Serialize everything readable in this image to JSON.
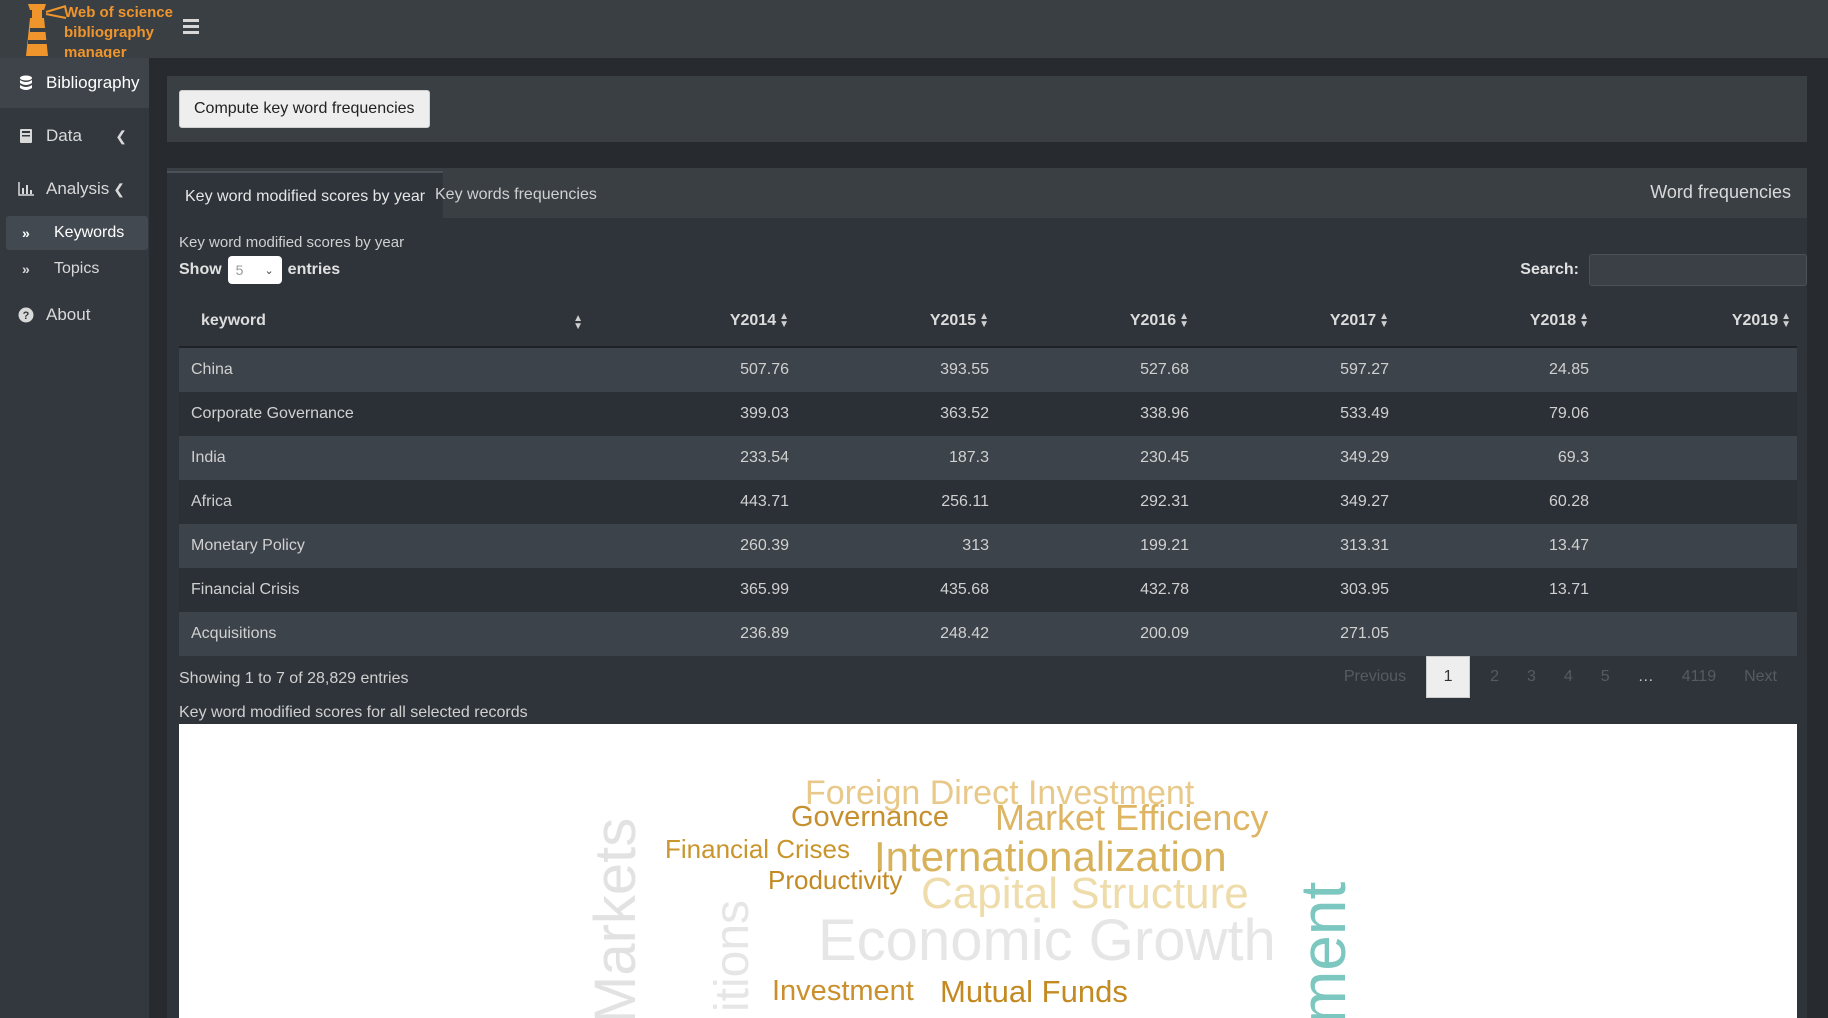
{
  "app": {
    "logo_lines": [
      "Web of science",
      "bibliography",
      "manager"
    ]
  },
  "sidebar": {
    "items": [
      {
        "label": "Bibliography",
        "icon": "database-icon"
      },
      {
        "label": "Data",
        "icon": "book-icon"
      },
      {
        "label": "Analysis",
        "icon": "bar-chart-icon"
      },
      {
        "label": "About",
        "icon": "question-circle-icon"
      }
    ],
    "subitems": [
      {
        "label": "Keywords",
        "icon": "angle-double-right-icon"
      },
      {
        "label": "Topics",
        "icon": "angle-double-right-icon"
      }
    ]
  },
  "toolbar": {
    "compute_label": "Compute key word frequencies"
  },
  "tabs": {
    "items": [
      "Key word modified scores by year",
      "Key words frequencies"
    ],
    "box_title": "Word frequencies"
  },
  "table_section": {
    "caption": "Key word modified scores by year",
    "show_label": "Show",
    "entries_value": "5",
    "entries_label": "entries",
    "search_label": "Search:",
    "columns": [
      "keyword",
      "Y2014",
      "Y2015",
      "Y2016",
      "Y2017",
      "Y2018",
      "Y2019"
    ],
    "rows": [
      [
        "China",
        "507.76",
        "393.55",
        "527.68",
        "597.27",
        "24.85",
        ""
      ],
      [
        "Corporate Governance",
        "399.03",
        "363.52",
        "338.96",
        "533.49",
        "79.06",
        ""
      ],
      [
        "India",
        "233.54",
        "187.3",
        "230.45",
        "349.29",
        "69.3",
        ""
      ],
      [
        "Africa",
        "443.71",
        "256.11",
        "292.31",
        "349.27",
        "60.28",
        ""
      ],
      [
        "Monetary Policy",
        "260.39",
        "313",
        "199.21",
        "313.31",
        "13.47",
        ""
      ],
      [
        "Financial Crisis",
        "365.99",
        "435.68",
        "432.78",
        "303.95",
        "13.71",
        ""
      ],
      [
        "Acquisitions",
        "236.89",
        "248.42",
        "200.09",
        "271.05",
        "",
        ""
      ]
    ],
    "info": "Showing 1 to 7 of 28,829 entries",
    "pagination": {
      "previous": "Previous",
      "pages": [
        "1",
        "2",
        "3",
        "4",
        "5",
        "…",
        "4119"
      ],
      "next": "Next"
    }
  },
  "wordcloud": {
    "caption": "Key word modified scores for all selected records",
    "words": [
      {
        "text": "Foreign Direct Investment",
        "color": "#e8c98a"
      },
      {
        "text": "Governance",
        "color": "#c6902f"
      },
      {
        "text": "Market Efficiency",
        "color": "#ddb563"
      },
      {
        "text": "Financial Crises",
        "color": "#c9952d"
      },
      {
        "text": "Internationalization",
        "color": "#d8b25a"
      },
      {
        "text": "Productivity",
        "color": "#c28a24"
      },
      {
        "text": "Capital Structure",
        "color": "#efdcab"
      },
      {
        "text": "Economic Growth",
        "color": "#e6e6e6"
      },
      {
        "text": "Investment",
        "color": "#c9902c"
      },
      {
        "text": "Mutual Funds",
        "color": "#c38a22"
      },
      {
        "text": "Markets",
        "color": "#e2e2e2"
      },
      {
        "text": "itions",
        "color": "#e6e6e6"
      },
      {
        "text": "ment",
        "color": "#7cc7bf"
      }
    ]
  }
}
